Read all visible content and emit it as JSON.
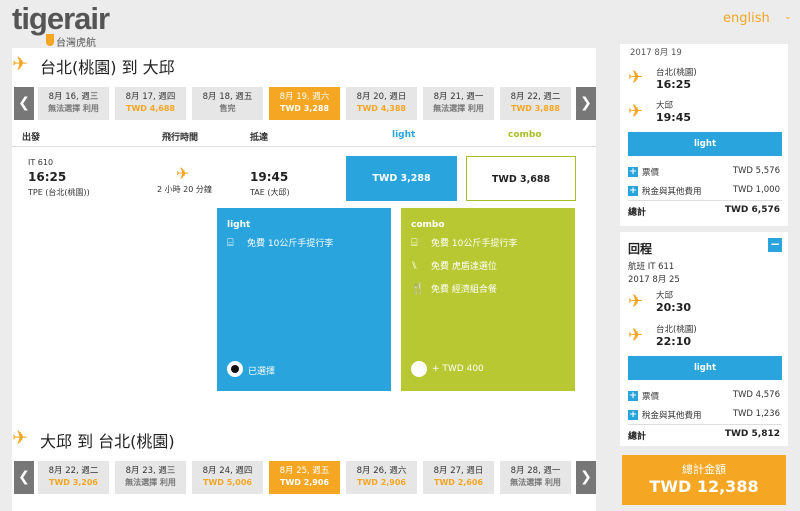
{
  "header": {
    "brand": "tigerair",
    "brand_sub": "台灣虎航",
    "language": "english",
    "language_caret": "⌄"
  },
  "outbound": {
    "title": "台北(桃園) 到 大邱",
    "prev_arrow": "❮",
    "next_arrow": "❯",
    "dates": [
      {
        "date": "8月 16, 週三",
        "price": "無法選擇 利用",
        "has_price": false,
        "selected": false
      },
      {
        "date": "8月 17, 週四",
        "price": "TWD 4,688",
        "has_price": true,
        "selected": false
      },
      {
        "date": "8月 18, 週五",
        "price": "售完",
        "has_price": false,
        "selected": false
      },
      {
        "date": "8月 19, 週六",
        "price": "TWD 3,288",
        "has_price": true,
        "selected": true
      },
      {
        "date": "8月 20, 週日",
        "price": "TWD 4,388",
        "has_price": true,
        "selected": false
      },
      {
        "date": "8月 21, 週一",
        "price": "無法選擇 利用",
        "has_price": false,
        "selected": false
      },
      {
        "date": "8月 22, 週二",
        "price": "TWD 3,888",
        "has_price": true,
        "selected": false
      }
    ],
    "columns": {
      "depart": "出發",
      "duration": "飛行時間",
      "arrive": "抵達",
      "light": "light",
      "combo": "combo"
    },
    "flight": {
      "number": "IT 610",
      "dep_time": "16:25",
      "dep_port": "TPE (台北(桃園))",
      "duration": "2 小時 20 分鐘",
      "arr_time": "19:45",
      "arr_port": "TAE (大邱)",
      "light_price": "TWD 3,288",
      "combo_price": "TWD 3,688"
    },
    "light_panel": {
      "title": "light",
      "features": [
        {
          "icon": "bag-icon",
          "glyph": "⌸",
          "text": "免費 10公斤手提行李"
        }
      ],
      "radio_label": "已選擇"
    },
    "combo_panel": {
      "title": "combo",
      "features": [
        {
          "icon": "bag-icon",
          "glyph": "⌸",
          "text": "免費 10公斤手提行李"
        },
        {
          "icon": "seat-icon",
          "glyph": "⑊",
          "text": "免費 虎盾達選位"
        },
        {
          "icon": "meal-icon",
          "glyph": "🍴",
          "text": "免費 經濟組合餐"
        }
      ],
      "radio_label": "+ TWD 400"
    }
  },
  "return_trip": {
    "title": "大邱 到 台北(桃園)",
    "dates": [
      {
        "date": "8月 22, 週二",
        "price": "TWD 3,206",
        "has_price": true,
        "selected": false
      },
      {
        "date": "8月 23, 週三",
        "price": "無法選擇 利用",
        "has_price": false,
        "selected": false
      },
      {
        "date": "8月 24, 週四",
        "price": "TWD 5,006",
        "has_price": true,
        "selected": false
      },
      {
        "date": "8月 25, 週五",
        "price": "TWD 2,906",
        "has_price": true,
        "selected": true
      },
      {
        "date": "8月 26, 週六",
        "price": "TWD 2,906",
        "has_price": true,
        "selected": false
      },
      {
        "date": "8月 27, 週日",
        "price": "TWD 2,606",
        "has_price": true,
        "selected": false
      },
      {
        "date": "8月 28, 週一",
        "price": "無法選擇 利用",
        "has_price": false,
        "selected": false
      }
    ]
  },
  "summary": {
    "outbound": {
      "date": "2017 8月 19",
      "dep_port": "台北(桃園)",
      "dep_time": "16:25",
      "arr_port": "大邱",
      "arr_time": "19:45",
      "fare_button": "light",
      "fare_label": "票價",
      "fare_amount": "TWD 5,576",
      "tax_label": "稅金與其他費用",
      "tax_amount": "TWD 1,000",
      "total_label": "總計",
      "total_amount": "TWD 6,576"
    },
    "inbound": {
      "heading": "回程",
      "collapse": "−",
      "flight": "航班 IT 611",
      "date": "2017 8月 25",
      "dep_port": "大邱",
      "dep_time": "20:30",
      "arr_port": "台北(桃園)",
      "arr_time": "22:10",
      "fare_button": "light",
      "fare_label": "票價",
      "fare_amount": "TWD 4,576",
      "tax_label": "稅金與其他費用",
      "tax_amount": "TWD 1,236",
      "total_label": "總計",
      "total_amount": "TWD 5,812"
    },
    "grand_label": "總計金額",
    "grand_amount": "TWD 12,388"
  },
  "colors": {
    "accent": "#f5a623",
    "light": "#29a4dc",
    "combo": "#b8c832"
  }
}
